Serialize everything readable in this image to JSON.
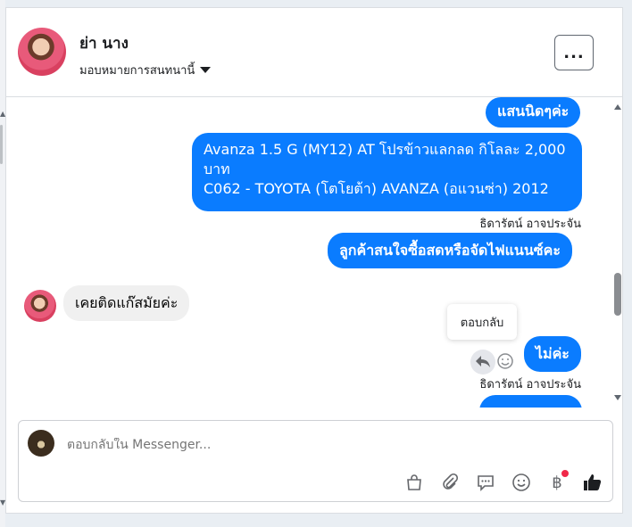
{
  "header": {
    "name": "ย่า นาง",
    "assign_label": "มอบหมายการสนทนานี้",
    "more_label": "..."
  },
  "messages": [
    {
      "direction": "out",
      "text": "แสนนิดๆค่ะ"
    },
    {
      "direction": "out",
      "lines": [
        "Avanza 1.5 G (MY12) AT โปรข้าวแลกลด กิโลละ 2,000",
        "บาท",
        "C062 - TOYOTA (โตโยต้า) AVANZA (อแวนซ่า) 2012"
      ]
    },
    {
      "direction": "out",
      "sender": "ธิดารัตน์ อาจประจัน"
    },
    {
      "direction": "out",
      "text": "ลูกค้าสนใจซื้อสดหรือจัดไฟแนนซ์คะ"
    },
    {
      "direction": "in",
      "text": "เคยติดแก๊สมัยค่ะ"
    },
    {
      "direction": "out",
      "text": "ไม่ค่ะ"
    },
    {
      "direction": "out",
      "sender": "ธิดารัตน์ อาจประจัน"
    }
  ],
  "tooltip": "ตอบกลับ",
  "composer": {
    "placeholder": "ตอบกลับใน Messenger...",
    "tools": [
      "gift-bag-icon",
      "paperclip-icon",
      "chat-icon",
      "emoji-icon",
      "baht-icon",
      "thumbs-up-icon"
    ]
  },
  "colors": {
    "outgoing_bubble": "#0a7cff",
    "incoming_bubble": "#f0f0f0",
    "badge": "#f02849"
  }
}
